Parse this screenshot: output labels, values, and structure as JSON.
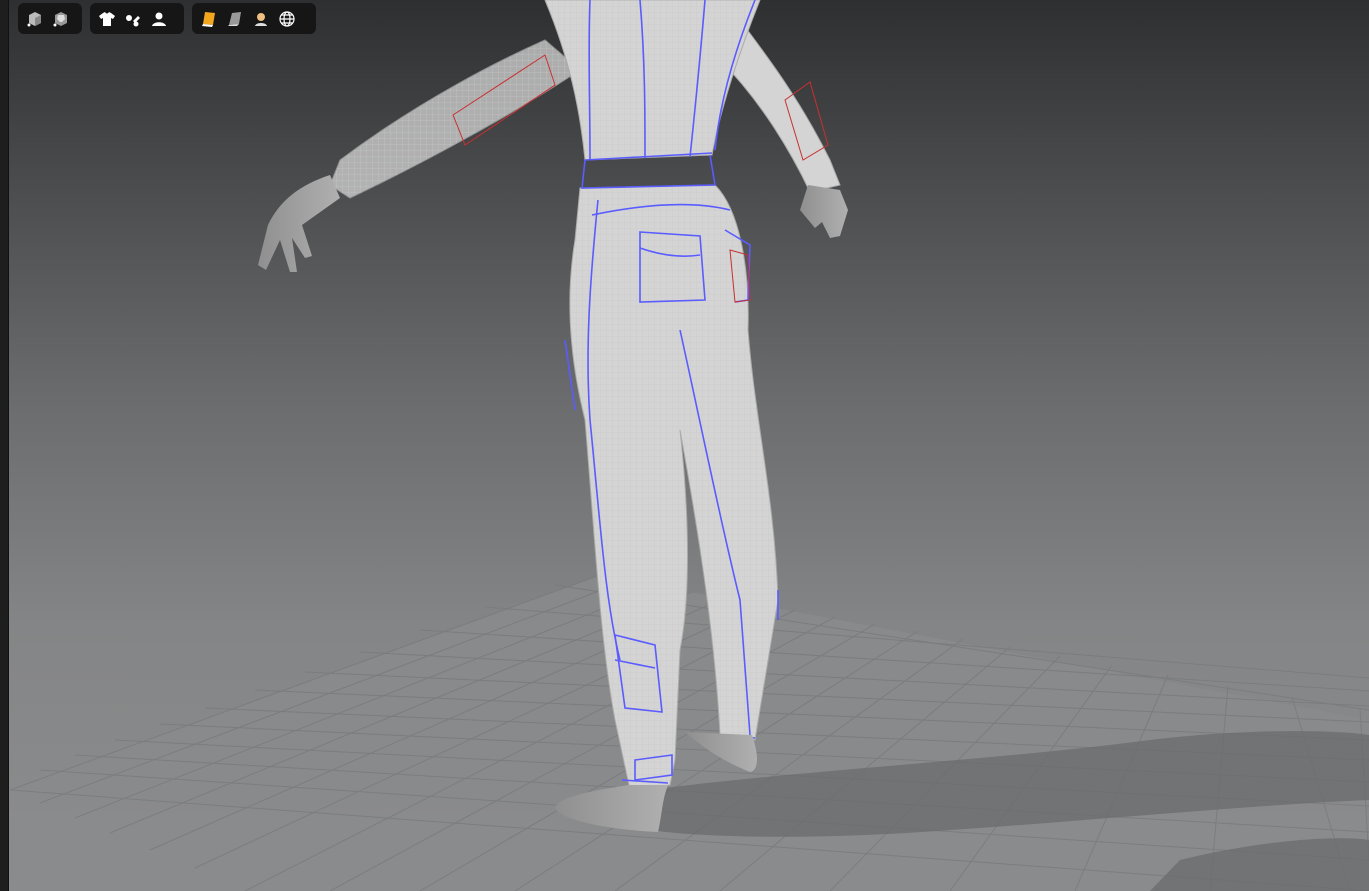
{
  "app": {
    "view": "3d-garment-viewport"
  },
  "toolbars": [
    {
      "group": "display-mode",
      "buttons": [
        {
          "icon": "solid-cube-icon",
          "tooltip": ""
        },
        {
          "icon": "textured-avatar-cube-icon",
          "tooltip": ""
        }
      ]
    },
    {
      "group": "visibility",
      "buttons": [
        {
          "icon": "shirt-icon",
          "tooltip": ""
        },
        {
          "icon": "tools-icon",
          "tooltip": ""
        },
        {
          "icon": "avatar-icon",
          "tooltip": ""
        }
      ]
    },
    {
      "group": "render-style",
      "buttons": [
        {
          "icon": "texture-swatch-icon",
          "tooltip": ""
        },
        {
          "icon": "shaded-surface-icon",
          "tooltip": ""
        },
        {
          "icon": "skin-avatar-icon",
          "tooltip": ""
        },
        {
          "icon": "globe-wireframe-icon",
          "tooltip": ""
        }
      ]
    }
  ],
  "colors": {
    "seam_line": "#5a5cff",
    "accent_orange": "#f2a51f",
    "internal_line": "#c83030",
    "toolbar_bg": "#161616"
  }
}
